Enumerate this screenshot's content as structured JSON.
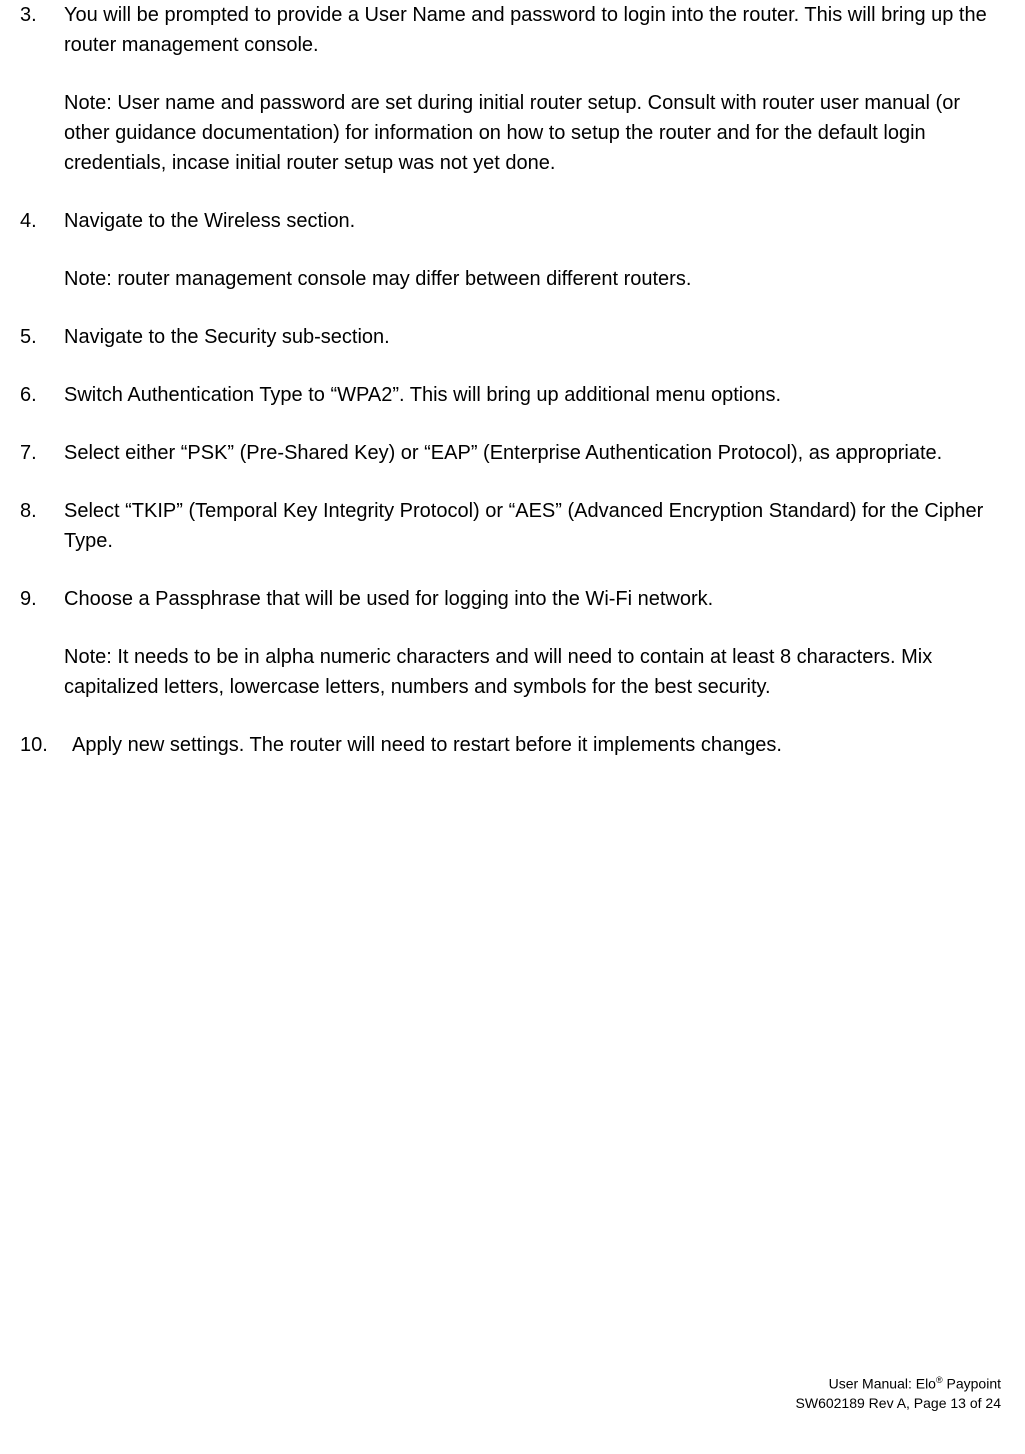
{
  "items": [
    {
      "num": "3.",
      "paras": [
        "You will be prompted to provide a User Name and password to login into the router. This will bring up the router management console.",
        "Note: User name and password are set during initial router setup. Consult with router user manual (or other guidance documentation) for information on how to setup the router and for the default login credentials, incase initial router setup was not yet done."
      ]
    },
    {
      "num": "4.",
      "paras": [
        "Navigate to the Wireless section.",
        "Note: router management console may differ between different routers."
      ]
    },
    {
      "num": "5.",
      "paras": [
        "Navigate to the Security sub-section."
      ]
    },
    {
      "num": "6.",
      "paras": [
        "Switch Authentication Type to “WPA2”. This will bring up additional menu options."
      ]
    },
    {
      "num": "7.",
      "paras": [
        "Select either “PSK” (Pre-Shared Key) or “EAP” (Enterprise Authentication Protocol), as appropriate."
      ]
    },
    {
      "num": "8.",
      "paras": [
        "Select “TKIP” (Temporal Key Integrity Protocol) or “AES” (Advanced Encryption Standard) for the Cipher Type."
      ]
    },
    {
      "num": "9.",
      "paras": [
        "Choose a Passphrase that will be used for logging into the Wi-Fi network.",
        "Note: It needs to be in alpha numeric characters and will need to contain at least 8 characters. Mix capitalized letters, lowercase letters, numbers and symbols for the best security."
      ]
    },
    {
      "num": "10.",
      "paras": [
        "Apply new settings. The router will need to restart before it implements changes."
      ]
    }
  ],
  "footer": {
    "line1_a": "User Manual: Elo",
    "line1_b": " Paypoint",
    "line2": "SW602189 Rev A, Page 13 of 24"
  }
}
